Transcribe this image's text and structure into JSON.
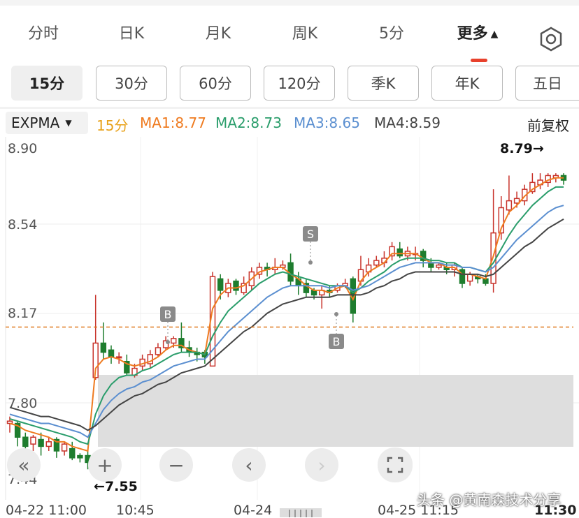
{
  "tabs": [
    {
      "label": "分时",
      "active": false
    },
    {
      "label": "日K",
      "active": false
    },
    {
      "label": "月K",
      "active": false
    },
    {
      "label": "周K",
      "active": false
    },
    {
      "label": "5分",
      "active": false
    },
    {
      "label": "更多",
      "active": true
    }
  ],
  "more_caret": "▲",
  "intervals": [
    {
      "label": "15分",
      "active": true
    },
    {
      "label": "30分",
      "active": false
    },
    {
      "label": "60分",
      "active": false
    },
    {
      "label": "120分",
      "active": false
    },
    {
      "label": "季K",
      "active": false
    },
    {
      "label": "年K",
      "active": false
    },
    {
      "label": "五日",
      "active": false
    }
  ],
  "legend": {
    "indicator": "EXPMA",
    "period": "15分",
    "ma1": "MA1:8.77",
    "ma2": "MA2:8.73",
    "ma3": "MA3:8.65",
    "ma4": "MA4:8.59",
    "adjust": "前复权"
  },
  "colors": {
    "up": "#c8332b",
    "down": "#1e7d2e",
    "ma1": "#ef7b20",
    "ma2": "#2a9d6b",
    "ma3": "#5b8fd0",
    "ma4": "#444444",
    "period": "#e8a21a",
    "refline": "#e07a20",
    "tab_accent": "#e8412c"
  },
  "chart": {
    "y_labels": [
      "8.90",
      "8.54",
      "8.17",
      "7.80",
      "7.44"
    ],
    "high_label": "8.79→",
    "low_label": "←7.55",
    "markers": [
      "B",
      "S",
      "B"
    ],
    "x_labels": [
      "04-22 11:00",
      "10:45",
      "04-24",
      "04-25 11:15",
      "11:30"
    ]
  },
  "chart_data": {
    "type": "candlestick",
    "ylim": [
      7.44,
      8.9
    ],
    "reference_price": 8.12,
    "high": 8.79,
    "low": 7.55,
    "x_ticks": [
      "04-22 11:00",
      "10:45",
      "04-24",
      "04-25 11:15",
      "11:30"
    ],
    "candles": [
      [
        7.7,
        7.71,
        7.73,
        7.66
      ],
      [
        7.7,
        7.64,
        7.71,
        7.6
      ],
      [
        7.64,
        7.6,
        7.66,
        7.57
      ],
      [
        7.61,
        7.64,
        7.65,
        7.58
      ],
      [
        7.63,
        7.6,
        7.66,
        7.56
      ],
      [
        7.6,
        7.62,
        7.64,
        7.58
      ],
      [
        7.63,
        7.58,
        7.64,
        7.55
      ],
      [
        7.58,
        7.61,
        7.62,
        7.56
      ],
      [
        7.59,
        7.55,
        7.62,
        7.54
      ],
      [
        7.56,
        7.55,
        7.57,
        7.53
      ],
      [
        7.56,
        7.53,
        7.58,
        7.5
      ],
      [
        7.9,
        8.05,
        8.26,
        7.89
      ],
      [
        8.05,
        8.01,
        8.14,
        7.98
      ],
      [
        8.02,
        7.99,
        8.04,
        7.96
      ],
      [
        7.99,
        7.99,
        8.01,
        7.96
      ],
      [
        7.97,
        7.92,
        8.0,
        7.91
      ],
      [
        7.91,
        7.94,
        7.96,
        7.9
      ],
      [
        7.95,
        7.98,
        8.0,
        7.93
      ],
      [
        7.96,
        8.0,
        8.02,
        7.94
      ],
      [
        8.0,
        8.03,
        8.05,
        7.99
      ],
      [
        8.03,
        8.06,
        8.08,
        8.02
      ],
      [
        8.05,
        8.07,
        8.08,
        8.03
      ],
      [
        8.07,
        8.03,
        8.14,
        8.01
      ],
      [
        8.03,
        8.01,
        8.06,
        7.99
      ],
      [
        8.01,
        8.0,
        8.03,
        7.97
      ],
      [
        8.01,
        7.99,
        8.02,
        7.96
      ],
      [
        7.95,
        8.34,
        8.36,
        7.95
      ],
      [
        8.33,
        8.28,
        8.35,
        8.24
      ],
      [
        8.27,
        8.31,
        8.33,
        8.25
      ],
      [
        8.32,
        8.28,
        8.33,
        8.26
      ],
      [
        8.27,
        8.31,
        8.34,
        8.26
      ],
      [
        8.3,
        8.36,
        8.38,
        8.28
      ],
      [
        8.35,
        8.38,
        8.4,
        8.33
      ],
      [
        8.38,
        8.37,
        8.4,
        8.34
      ],
      [
        8.37,
        8.38,
        8.42,
        8.35
      ],
      [
        8.38,
        8.39,
        8.41,
        8.37
      ],
      [
        8.4,
        8.32,
        8.44,
        8.3
      ],
      [
        8.33,
        8.3,
        8.36,
        8.26
      ],
      [
        8.31,
        8.27,
        8.33,
        8.25
      ],
      [
        8.28,
        8.26,
        8.29,
        8.24
      ],
      [
        8.26,
        8.28,
        8.3,
        8.2
      ],
      [
        8.28,
        8.27,
        8.3,
        8.25
      ],
      [
        8.28,
        8.3,
        8.31,
        8.27
      ],
      [
        8.3,
        8.31,
        8.33,
        8.29
      ],
      [
        8.33,
        8.18,
        8.34,
        8.14
      ],
      [
        8.32,
        8.37,
        8.43,
        8.3
      ],
      [
        8.36,
        8.39,
        8.42,
        8.34
      ],
      [
        8.39,
        8.41,
        8.43,
        8.38
      ],
      [
        8.4,
        8.42,
        8.45,
        8.38
      ],
      [
        8.43,
        8.47,
        8.49,
        8.41
      ],
      [
        8.46,
        8.43,
        8.49,
        8.42
      ],
      [
        8.43,
        8.45,
        8.47,
        8.41
      ],
      [
        8.44,
        8.44,
        8.47,
        8.41
      ],
      [
        8.45,
        8.41,
        8.46,
        8.38
      ],
      [
        8.4,
        8.38,
        8.42,
        8.36
      ],
      [
        8.38,
        8.39,
        8.4,
        8.37
      ],
      [
        8.38,
        8.37,
        8.4,
        8.35
      ],
      [
        8.37,
        8.39,
        8.4,
        8.34
      ],
      [
        8.37,
        8.31,
        8.38,
        8.29
      ],
      [
        8.32,
        8.35,
        8.36,
        8.3
      ],
      [
        8.34,
        8.33,
        8.35,
        8.31
      ],
      [
        8.33,
        8.31,
        8.35,
        8.3
      ],
      [
        8.31,
        8.53,
        8.72,
        8.27
      ],
      [
        8.53,
        8.64,
        8.69,
        8.5
      ],
      [
        8.63,
        8.67,
        8.78,
        8.61
      ],
      [
        8.66,
        8.68,
        8.71,
        8.64
      ],
      [
        8.67,
        8.72,
        8.74,
        8.65
      ],
      [
        8.71,
        8.75,
        8.79,
        8.7
      ],
      [
        8.74,
        8.76,
        8.79,
        8.72
      ],
      [
        8.75,
        8.78,
        8.79,
        8.73
      ],
      [
        8.77,
        8.78,
        8.79,
        8.75
      ],
      [
        8.78,
        8.76,
        8.79,
        8.74
      ]
    ],
    "series": [
      {
        "name": "MA1",
        "values": [
          7.7,
          7.69,
          7.67,
          7.66,
          7.65,
          7.64,
          7.62,
          7.62,
          7.6,
          7.59,
          7.58,
          7.94,
          7.98,
          7.99,
          7.98,
          7.96,
          7.95,
          7.96,
          7.97,
          7.99,
          8.02,
          8.04,
          8.04,
          8.02,
          8.01,
          8.0,
          8.2,
          8.26,
          8.29,
          8.29,
          8.3,
          8.33,
          8.36,
          8.37,
          8.38,
          8.38,
          8.35,
          8.33,
          8.3,
          8.28,
          8.28,
          8.27,
          8.29,
          8.3,
          8.24,
          8.32,
          8.36,
          8.38,
          8.4,
          8.44,
          8.44,
          8.44,
          8.44,
          8.42,
          8.4,
          8.4,
          8.38,
          8.38,
          8.35,
          8.35,
          8.34,
          8.33,
          8.43,
          8.55,
          8.62,
          8.65,
          8.69,
          8.72,
          8.74,
          8.76,
          8.77,
          8.77
        ]
      },
      {
        "name": "MA2",
        "values": [
          7.72,
          7.71,
          7.7,
          7.69,
          7.68,
          7.67,
          7.66,
          7.65,
          7.64,
          7.62,
          7.61,
          7.74,
          7.82,
          7.87,
          7.9,
          7.91,
          7.91,
          7.93,
          7.94,
          7.96,
          7.98,
          8.0,
          8.01,
          8.01,
          8.01,
          8.0,
          8.08,
          8.14,
          8.19,
          8.22,
          8.25,
          8.28,
          8.31,
          8.33,
          8.35,
          8.36,
          8.35,
          8.34,
          8.33,
          8.32,
          8.31,
          8.3,
          8.3,
          8.3,
          8.27,
          8.29,
          8.32,
          8.34,
          8.36,
          8.39,
          8.41,
          8.42,
          8.42,
          8.42,
          8.41,
          8.41,
          8.4,
          8.4,
          8.38,
          8.38,
          8.37,
          8.36,
          8.4,
          8.46,
          8.52,
          8.57,
          8.61,
          8.65,
          8.68,
          8.71,
          8.73,
          8.73
        ]
      },
      {
        "name": "MA3",
        "values": [
          7.74,
          7.73,
          7.72,
          7.71,
          7.7,
          7.7,
          7.69,
          7.68,
          7.67,
          7.66,
          7.64,
          7.7,
          7.76,
          7.8,
          7.83,
          7.85,
          7.86,
          7.88,
          7.89,
          7.91,
          7.93,
          7.95,
          7.96,
          7.97,
          7.98,
          7.98,
          8.02,
          8.06,
          8.1,
          8.13,
          8.16,
          8.19,
          8.22,
          8.25,
          8.27,
          8.29,
          8.3,
          8.3,
          8.3,
          8.3,
          8.3,
          8.29,
          8.3,
          8.3,
          8.28,
          8.29,
          8.3,
          8.32,
          8.34,
          8.36,
          8.38,
          8.39,
          8.4,
          8.4,
          8.4,
          8.4,
          8.39,
          8.39,
          8.38,
          8.38,
          8.37,
          8.36,
          8.38,
          8.42,
          8.46,
          8.5,
          8.53,
          8.56,
          8.59,
          8.62,
          8.64,
          8.65
        ]
      },
      {
        "name": "MA4",
        "values": [
          7.77,
          7.76,
          7.75,
          7.74,
          7.73,
          7.73,
          7.72,
          7.71,
          7.7,
          7.69,
          7.67,
          7.69,
          7.72,
          7.75,
          7.78,
          7.8,
          7.82,
          7.83,
          7.85,
          7.87,
          7.88,
          7.9,
          7.92,
          7.93,
          7.94,
          7.95,
          7.98,
          8.01,
          8.04,
          8.07,
          8.1,
          8.12,
          8.15,
          8.18,
          8.2,
          8.22,
          8.23,
          8.24,
          8.25,
          8.25,
          8.25,
          8.25,
          8.26,
          8.26,
          8.26,
          8.26,
          8.27,
          8.29,
          8.3,
          8.32,
          8.33,
          8.35,
          8.36,
          8.36,
          8.36,
          8.36,
          8.36,
          8.36,
          8.35,
          8.35,
          8.35,
          8.34,
          8.35,
          8.38,
          8.41,
          8.44,
          8.47,
          8.49,
          8.52,
          8.55,
          8.57,
          8.59
        ]
      }
    ]
  },
  "controls": {
    "rewind": "«",
    "zoom_in": "+",
    "zoom_out": "−",
    "prev": "‹",
    "next": "›"
  },
  "watermark": "头条 @黄南森技术分享"
}
